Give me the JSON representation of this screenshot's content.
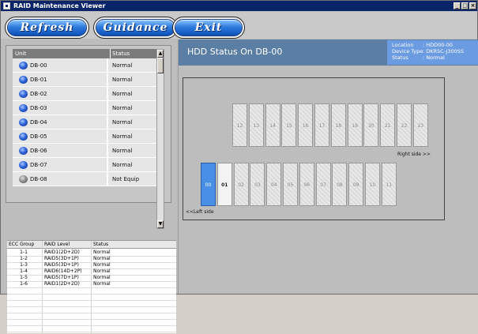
{
  "window": {
    "title": "RAID Maintenance Viewer",
    "controls": [
      "_",
      "□",
      "×"
    ]
  },
  "toolbar": {
    "refresh_label": "Refresh",
    "guidance_label": "Guidance",
    "exit_label": "Exit"
  },
  "units": {
    "columns": [
      "Unit",
      "Status"
    ],
    "rows": [
      {
        "name": "DB-00",
        "status": "Normal",
        "icon": "blue-disk-icon"
      },
      {
        "name": "DB-01",
        "status": "Normal",
        "icon": "blue-disk-icon"
      },
      {
        "name": "DB-02",
        "status": "Normal",
        "icon": "blue-disk-icon"
      },
      {
        "name": "DB-03",
        "status": "Normal",
        "icon": "blue-disk-icon"
      },
      {
        "name": "DB-04",
        "status": "Normal",
        "icon": "blue-disk-icon"
      },
      {
        "name": "DB-05",
        "status": "Normal",
        "icon": "blue-disk-icon"
      },
      {
        "name": "DB-06",
        "status": "Normal",
        "icon": "blue-disk-icon"
      },
      {
        "name": "DB-07",
        "status": "Normal",
        "icon": "blue-disk-icon"
      },
      {
        "name": "DB-08",
        "status": "Not Equip",
        "icon": "gray-disk-icon"
      }
    ],
    "scroll_up": "▲",
    "scroll_down": "▼"
  },
  "ecc": {
    "columns": [
      "ECC Group",
      "RAID Level",
      "Status"
    ],
    "rows": [
      [
        "1-1",
        "RAID1(2D+2D)",
        "Normal"
      ],
      [
        "1-2",
        "RAID5(3D+1P)",
        "Normal"
      ],
      [
        "1-3",
        "RAID5(3D+1P)",
        "Normal"
      ],
      [
        "1-4",
        "RAID6(14D+2P)",
        "Normal"
      ],
      [
        "1-5",
        "RAID5(7D+1P)",
        "Normal"
      ],
      [
        "1-6",
        "RAID1(2D+2D)",
        "Normal"
      ]
    ]
  },
  "hdd": {
    "title": "HDD Status On DB-00",
    "info": [
      {
        "label": "Location",
        "value": ": HDD00-00"
      },
      {
        "label": "Device Type",
        "value": ": DKR5C-J300SS"
      },
      {
        "label": "Status",
        "value": ": Normal"
      }
    ],
    "right_bays": [
      "12",
      "13",
      "14",
      "15",
      "16",
      "17",
      "18",
      "19",
      "20",
      "21",
      "22",
      "23"
    ],
    "left_bays": [
      {
        "label": "00",
        "state": "selected"
      },
      {
        "label": "01",
        "state": "installed"
      },
      {
        "label": "02",
        "state": "empty"
      },
      {
        "label": "03",
        "state": "empty"
      },
      {
        "label": "04",
        "state": "empty"
      },
      {
        "label": "05",
        "state": "empty"
      },
      {
        "label": "06",
        "state": "empty"
      },
      {
        "label": "07",
        "state": "empty"
      },
      {
        "label": "08",
        "state": "empty"
      },
      {
        "label": "09",
        "state": "empty"
      },
      {
        "label": "10",
        "state": "empty"
      },
      {
        "label": "11",
        "state": "empty"
      }
    ],
    "right_side_label": "Right side >>",
    "left_side_label": "<<Left side"
  },
  "colors": {
    "titlebar": "#0a246a",
    "button_blue": "#2f7de0",
    "header_bg": "#5b7ea5",
    "selected_bay": "#4a8fe6"
  }
}
